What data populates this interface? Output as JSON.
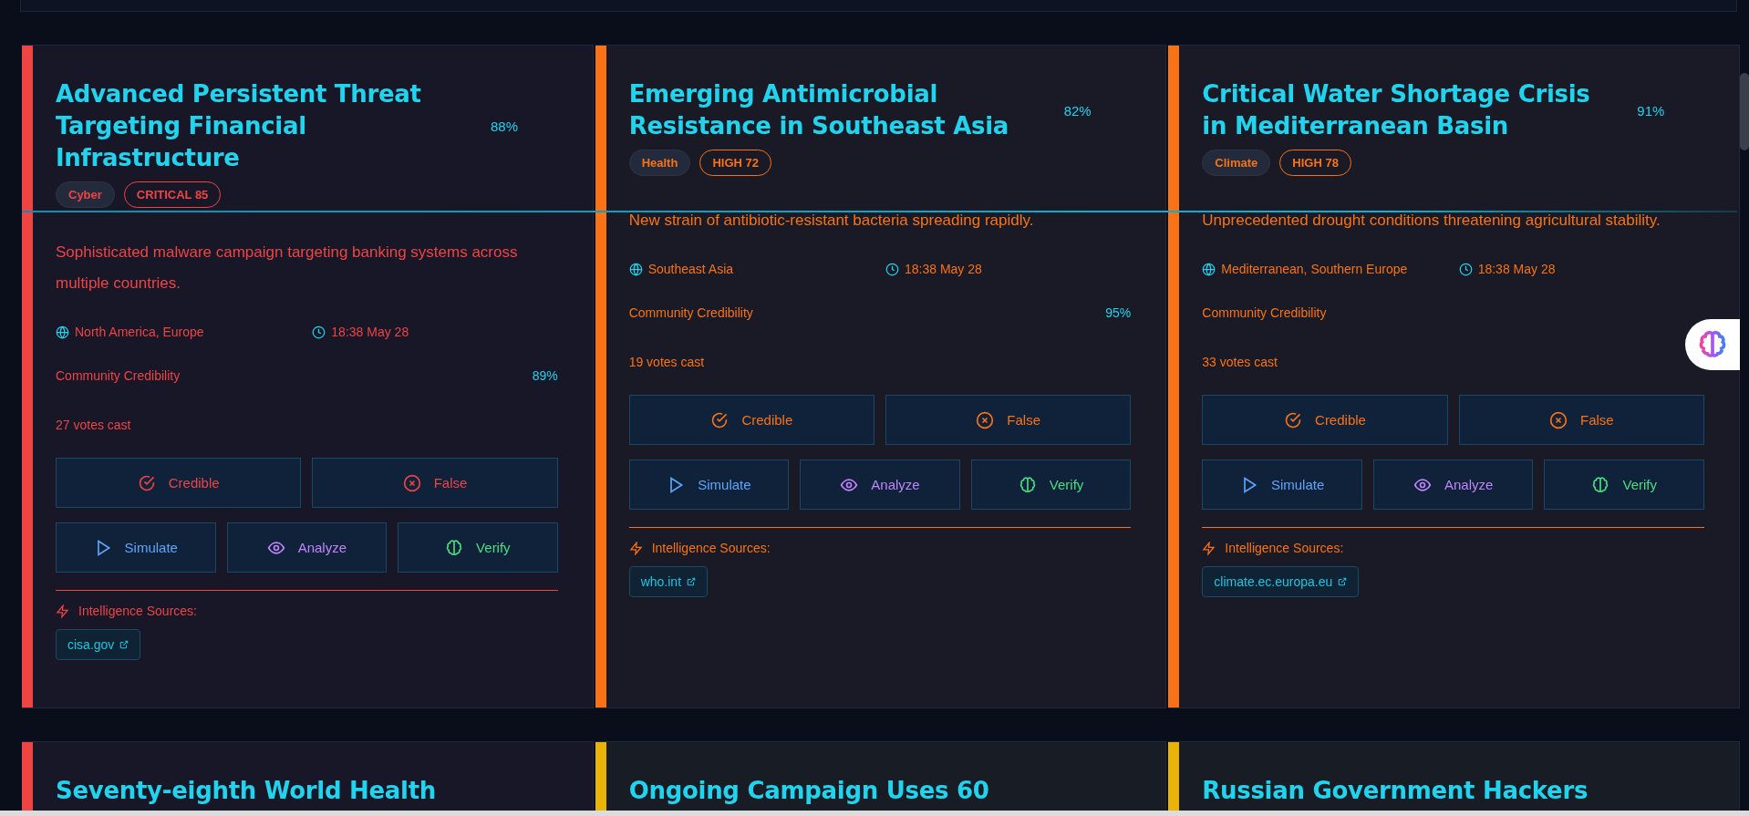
{
  "cards": [
    {
      "color": "#ef4444",
      "title": "Advanced Persistent Threat Targeting Financial Infrastructure",
      "confidence": "88%",
      "category": "Cyber",
      "severity_badge": "CRITICAL 85",
      "description": "Sophisticated malware campaign targeting banking systems across multiple countries.",
      "region": "North America, Europe",
      "time": "18:38 May 28",
      "credibility_label": "Community Credibility",
      "credibility": "89%",
      "votes": "27 votes cast",
      "actions": [
        {
          "kind": "credible",
          "label": "Credible"
        },
        {
          "kind": "false",
          "label": "False"
        },
        {
          "kind": "simulate",
          "label": "Simulate"
        },
        {
          "kind": "analyze",
          "label": "Analyze"
        },
        {
          "kind": "verify",
          "label": "Verify"
        }
      ],
      "sources_label": "Intelligence Sources:",
      "sources": [
        "cisa.gov"
      ]
    },
    {
      "color": "#f97316",
      "title": "Emerging Antimicrobial Resistance in Southeast Asia",
      "confidence": "82%",
      "category": "Health",
      "severity_badge": "HIGH 72",
      "description": "New strain of antibiotic-resistant bacteria spreading rapidly.",
      "region": "Southeast Asia",
      "time": "18:38 May 28",
      "credibility_label": "Community Credibility",
      "credibility": "95%",
      "votes": "19 votes cast",
      "actions": [
        {
          "kind": "credible",
          "label": "Credible"
        },
        {
          "kind": "false",
          "label": "False"
        },
        {
          "kind": "simulate",
          "label": "Simulate"
        },
        {
          "kind": "analyze",
          "label": "Analyze"
        },
        {
          "kind": "verify",
          "label": "Verify"
        }
      ],
      "sources_label": "Intelligence Sources:",
      "sources": [
        "who.int"
      ]
    },
    {
      "color": "#f97316",
      "title": "Critical Water Shortage Crisis in Mediterranean Basin",
      "confidence": "91%",
      "category": "Climate",
      "severity_badge": "HIGH 78",
      "description": "Unprecedented drought conditions threatening agricultural stability.",
      "region": "Mediterranean, Southern Europe",
      "time": "18:38 May 28",
      "credibility_label": "Community Credibility",
      "votes": "33 votes cast",
      "actions": [
        {
          "kind": "credible",
          "label": "Credible"
        },
        {
          "kind": "false",
          "label": "False"
        },
        {
          "kind": "simulate",
          "label": "Simulate"
        },
        {
          "kind": "analyze",
          "label": "Analyze"
        },
        {
          "kind": "verify",
          "label": "Verify"
        }
      ],
      "sources_label": "Intelligence Sources:",
      "sources": [
        "climate.ec.europa.eu"
      ]
    },
    {
      "color": "#ef4444",
      "title": "Seventy-eighth World Health"
    },
    {
      "color": "#eab308",
      "title": "Ongoing Campaign Uses 60"
    },
    {
      "color": "#eab308",
      "title": "Russian Government Hackers"
    }
  ]
}
